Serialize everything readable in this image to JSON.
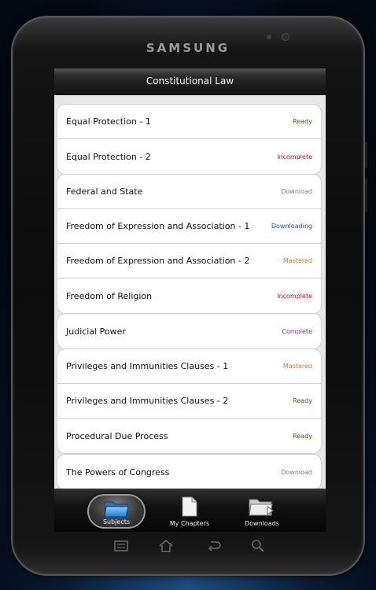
{
  "device": {
    "brand": "SAMSUNG"
  },
  "app": {
    "title": "Constitutional Law"
  },
  "status_colors": {
    "Ready": "#2f6b16",
    "Incomplete": "#b51a1a",
    "Download": "#7a7a7a",
    "Downloading": "#1c4f9c",
    "Mastered": "#e07b1e",
    "Complete": "#7b2fa8"
  },
  "groups": [
    {
      "items": [
        {
          "title": "Equal Protection - 1",
          "status": "Ready"
        },
        {
          "title": "Equal Protection - 2",
          "status": "Incomplete"
        }
      ]
    },
    {
      "items": [
        {
          "title": "Federal and State",
          "status": "Download"
        },
        {
          "title": "Freedom of Expression and Association - 1",
          "status": "Downloading"
        },
        {
          "title": "Freedom of Expression and Association - 2",
          "status": "Mastered"
        },
        {
          "title": "Freedom of Religion",
          "status": "Incomplete"
        }
      ]
    },
    {
      "items": [
        {
          "title": "Judicial Power",
          "status": "Complete"
        }
      ]
    },
    {
      "items": [
        {
          "title": "Privileges and Immunities Clauses - 1",
          "status": "Mastered"
        },
        {
          "title": "Privileges and Immunities Clauses - 2",
          "status": "Ready"
        },
        {
          "title": "Procedural Due Process",
          "status": "Ready"
        }
      ]
    },
    {
      "items": [
        {
          "title": "The Powers of Congress",
          "status": "Download"
        }
      ]
    }
  ],
  "tabs": [
    {
      "label": "Subjects",
      "icon": "folder-icon",
      "active": true
    },
    {
      "label": "My Chapters",
      "icon": "document-icon",
      "active": false
    },
    {
      "label": "Downloads",
      "icon": "download-folder-icon",
      "active": false
    }
  ],
  "hardware_keys": [
    {
      "icon": "menu-icon"
    },
    {
      "icon": "home-icon"
    },
    {
      "icon": "back-icon"
    },
    {
      "icon": "search-icon"
    }
  ]
}
